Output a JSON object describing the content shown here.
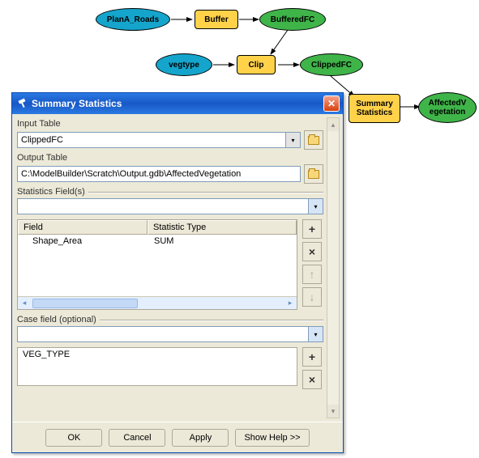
{
  "diagram": {
    "nodes": {
      "plana": "PlanA_Roads",
      "buffer": "Buffer",
      "bufferedfc": "BufferedFC",
      "vegtype": "vegtype",
      "clip": "Clip",
      "clippedfc": "ClippedFC",
      "sumstats": "Summary\nStatistics",
      "affected": "AffectedV\negetation"
    }
  },
  "dialog": {
    "title": "Summary Statistics",
    "labels": {
      "input_table": "Input Table",
      "output_table": "Output Table",
      "stats_fields": "Statistics Field(s)",
      "case_field": "Case field (optional)"
    },
    "input_table_value": "ClippedFC",
    "output_table_value": "C:\\ModelBuilder\\Scratch\\Output.gdb\\AffectedVegetation",
    "table": {
      "headers": {
        "field": "Field",
        "stat": "Statistic Type"
      },
      "rows": [
        {
          "field": "Shape_Area",
          "stat": "SUM"
        }
      ]
    },
    "case_fields": [
      "VEG_TYPE"
    ],
    "buttons": {
      "ok": "OK",
      "cancel": "Cancel",
      "apply": "Apply",
      "help": "Show Help >>"
    }
  }
}
